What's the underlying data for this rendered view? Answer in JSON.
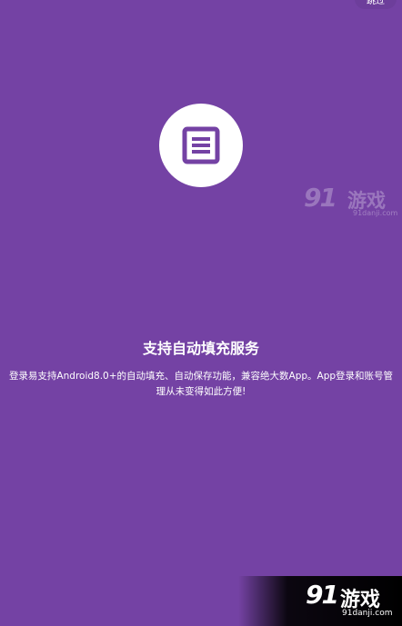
{
  "header": {
    "skip_label": "跳过"
  },
  "feature": {
    "icon": "document-list-icon",
    "title": "支持自动填充服务",
    "description": "登录易支持Android8.0+的自动填充、自动保存功能，兼容绝大数App。App登录和账号管理从未变得如此方便!"
  },
  "watermark": {
    "logo": "91",
    "text": "游戏",
    "domain": "91danji.com"
  },
  "colors": {
    "background": "#7442a4",
    "icon_color": "#7442a4",
    "circle": "#ffffff"
  }
}
